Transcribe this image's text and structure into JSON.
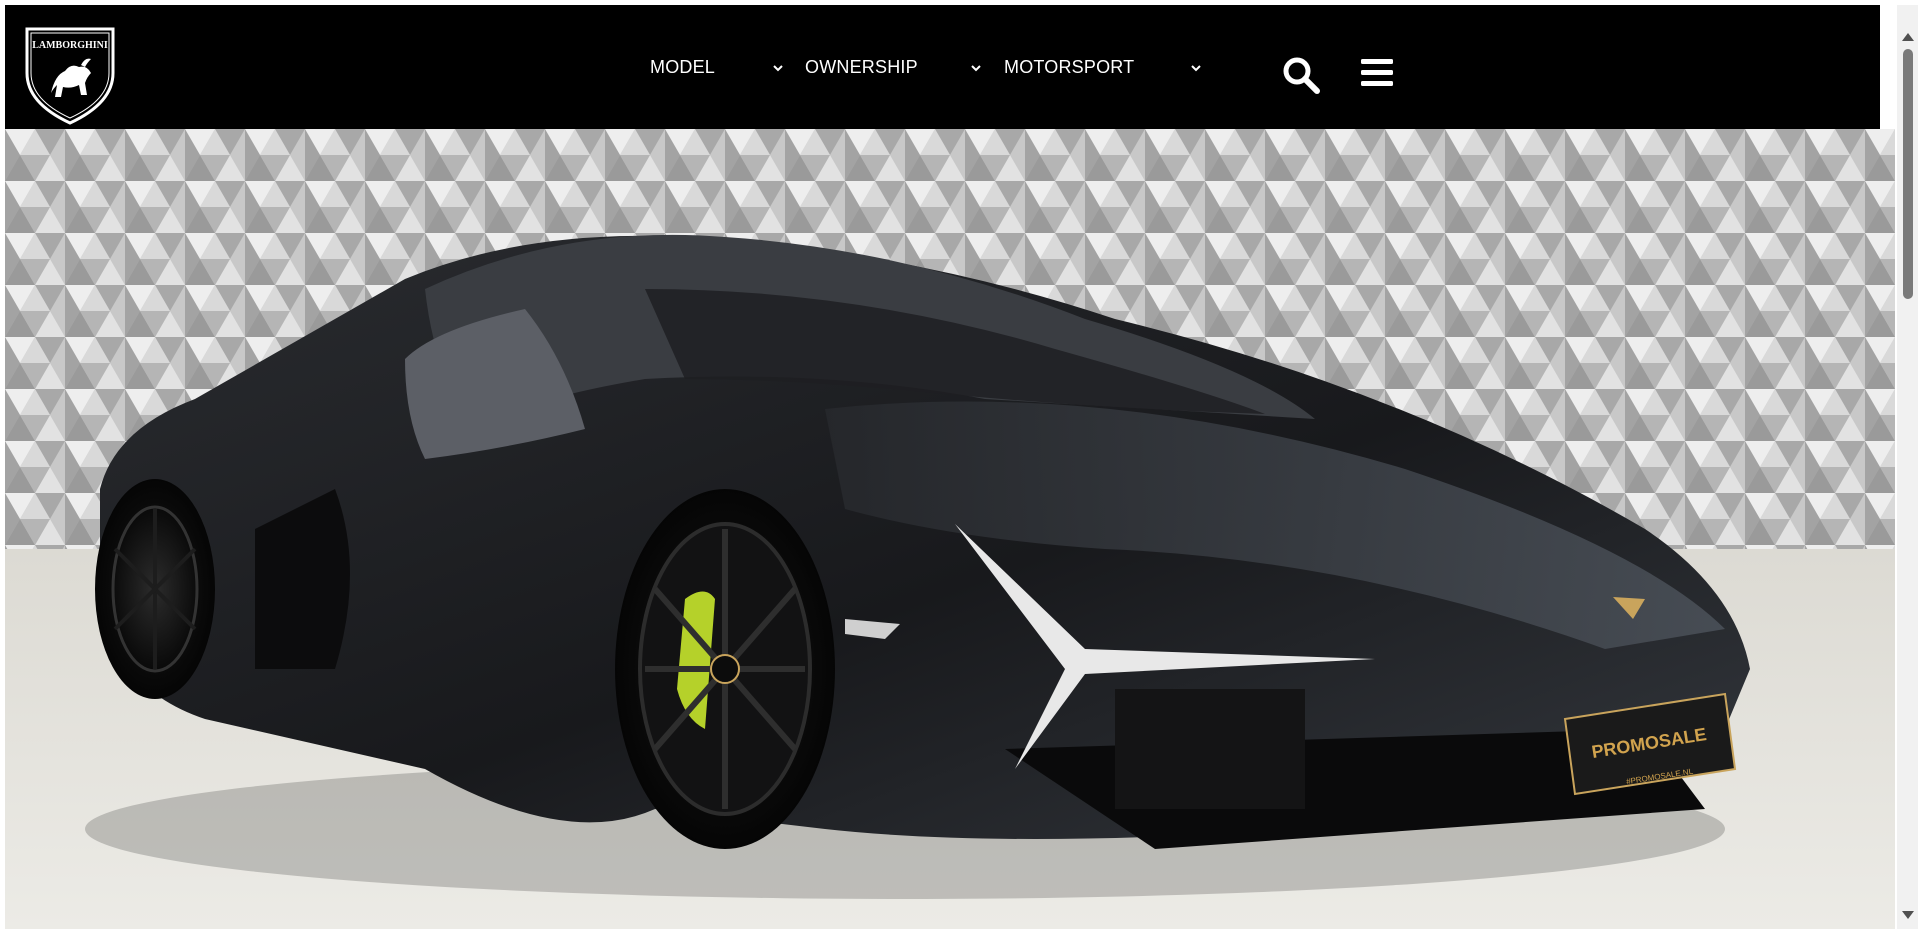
{
  "brand": {
    "logo_text": "LAMBORGHINI"
  },
  "nav": {
    "items": [
      {
        "label": "MODEL"
      },
      {
        "label": "OWNERSHIP"
      },
      {
        "label": "MOTORSPORT"
      }
    ],
    "search_icon": "search-icon",
    "menu_icon": "hamburger-menu-icon"
  },
  "hero": {
    "image": "black-lamborghini-revuelto-in-showroom",
    "plate_text": "PROMOSALE",
    "plate_subtext": "#PROMOSALE.NL"
  },
  "colors": {
    "navbar": "#000000",
    "nav_text": "#ffffff",
    "caliper": "#b5d12a",
    "wall": "#c9c9c9",
    "floor": "#e9e6df"
  }
}
